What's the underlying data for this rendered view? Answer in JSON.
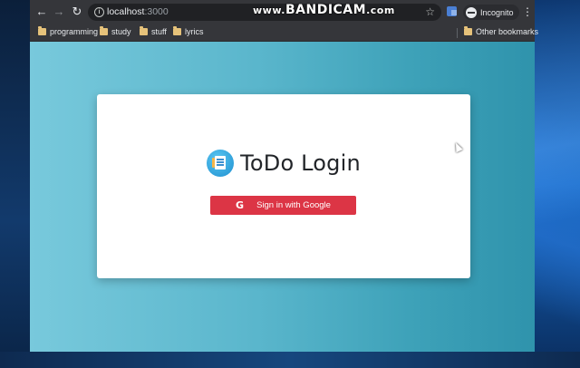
{
  "browser": {
    "url_host": "localhost",
    "url_port": ":3000",
    "profile_label": "Incognito",
    "bookmarks": [
      {
        "label": "programming"
      },
      {
        "label": "study"
      },
      {
        "label": "stuff"
      },
      {
        "label": "lyrics"
      }
    ],
    "other_bookmarks_label": "Other bookmarks"
  },
  "watermark": {
    "prefix": "www.",
    "main": "BANDICAM",
    "suffix": ".com"
  },
  "login": {
    "title": "ToDo Login",
    "google_button_icon": "G",
    "google_button_label": "Sign in with Google",
    "button_color": "#dc3545"
  },
  "icons": {
    "back": "arrow-left-icon",
    "forward": "arrow-right-icon",
    "reload": "reload-icon",
    "info": "info-icon",
    "star": "star-icon",
    "menu": "kebab-menu-icon",
    "logo": "todo-notepad-icon"
  }
}
